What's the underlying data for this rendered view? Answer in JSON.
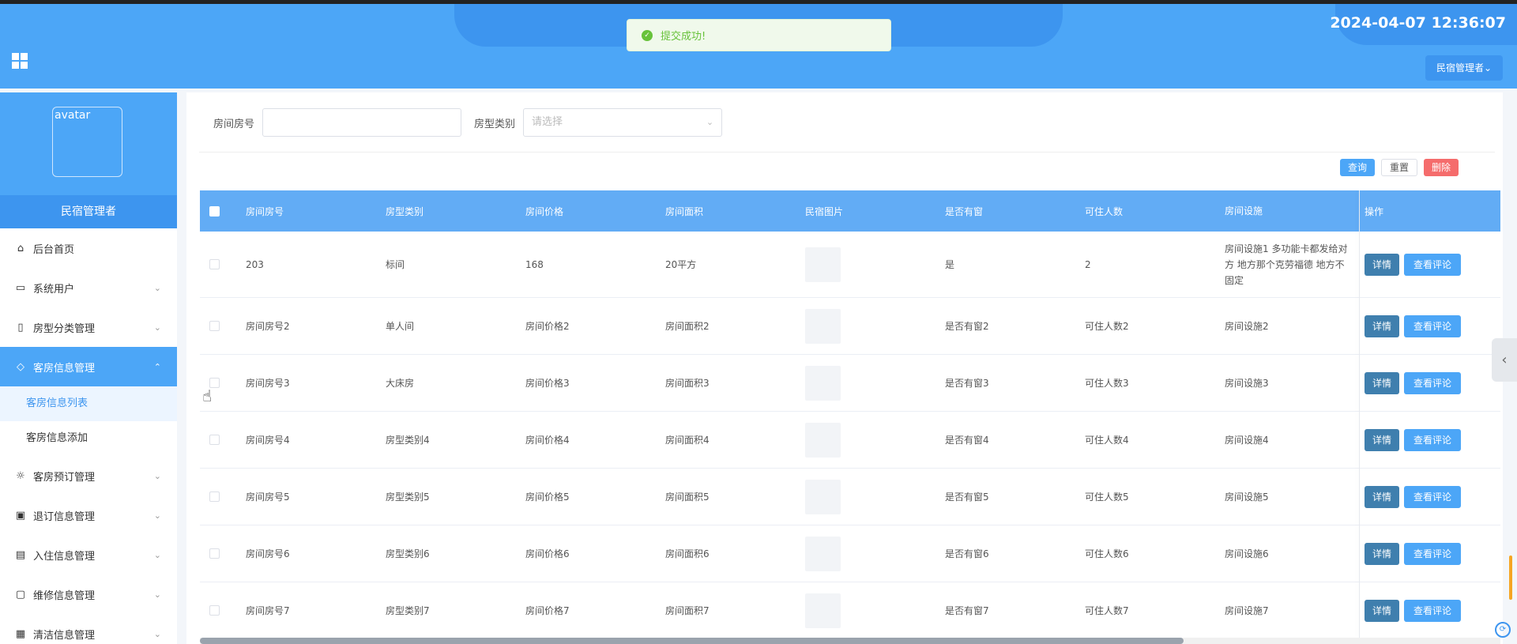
{
  "header": {
    "datetime": "2024-04-07 12:36:07",
    "user_menu": "民宿管理者⌄"
  },
  "toast": {
    "message": "提交成功!"
  },
  "sidebar": {
    "avatar_alt": "avatar",
    "profile_name": "民宿管理者",
    "items": [
      {
        "label": "后台首页",
        "icon": "home-icon",
        "glyph": "⌂"
      },
      {
        "label": "系统用户",
        "icon": "laptop-icon",
        "glyph": "▭"
      },
      {
        "label": "房型分类管理",
        "icon": "bookmark-icon",
        "glyph": "▯"
      },
      {
        "label": "客房信息管理",
        "icon": "tag-icon",
        "glyph": "◇"
      },
      {
        "label": "客房预订管理",
        "icon": "sun-icon",
        "glyph": "☼"
      },
      {
        "label": "退订信息管理",
        "icon": "inbox-icon",
        "glyph": "▣"
      },
      {
        "label": "入住信息管理",
        "icon": "clipboard-icon",
        "glyph": "▤"
      },
      {
        "label": "维修信息管理",
        "icon": "chat-icon",
        "glyph": "▢"
      },
      {
        "label": "清洁信息管理",
        "icon": "box-icon",
        "glyph": "▦"
      }
    ],
    "sub_items": [
      "客房信息列表",
      "客房信息添加"
    ]
  },
  "filter": {
    "room_no_label": "房间房号",
    "room_type_label": "房型类别",
    "room_type_placeholder": "请选择"
  },
  "actions": {
    "query": "查询",
    "reset": "重置",
    "delete": "删除"
  },
  "table": {
    "headers": [
      "房间房号",
      "房型类别",
      "房间价格",
      "房间面积",
      "民宿图片",
      "是否有窗",
      "可住人数",
      "房间设施",
      "操作"
    ],
    "detail_label": "详情",
    "review_label": "查看评论",
    "rows": [
      [
        "203",
        "标间",
        "168",
        "20平方",
        "是",
        "2",
        "房间设施1 多功能卡都发给对方 地方那个克劳福德 地方不固定"
      ],
      [
        "房间房号2",
        "单人间",
        "房间价格2",
        "房间面积2",
        "是否有窗2",
        "可住人数2",
        "房间设施2"
      ],
      [
        "房间房号3",
        "大床房",
        "房间价格3",
        "房间面积3",
        "是否有窗3",
        "可住人数3",
        "房间设施3"
      ],
      [
        "房间房号4",
        "房型类别4",
        "房间价格4",
        "房间面积4",
        "是否有窗4",
        "可住人数4",
        "房间设施4"
      ],
      [
        "房间房号5",
        "房型类别5",
        "房间价格5",
        "房间面积5",
        "是否有窗5",
        "可住人数5",
        "房间设施5"
      ],
      [
        "房间房号6",
        "房型类别6",
        "房间价格6",
        "房间面积6",
        "是否有窗6",
        "可住人数6",
        "房间设施6"
      ],
      [
        "房间房号7",
        "房型类别7",
        "房间价格7",
        "房间面积7",
        "是否有窗7",
        "可住人数7",
        "房间设施7"
      ]
    ]
  }
}
